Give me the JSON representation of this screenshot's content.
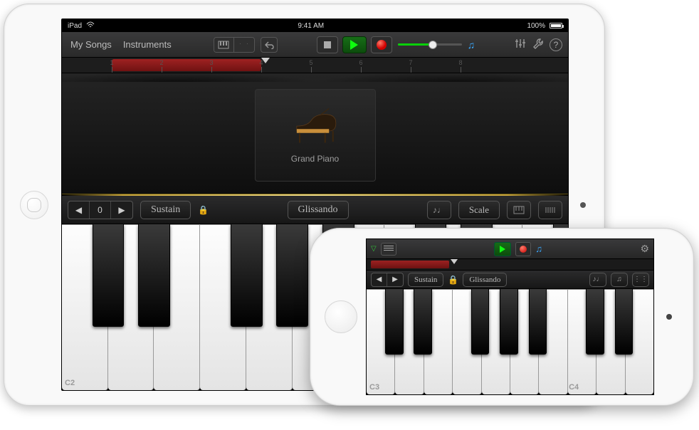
{
  "ipad": {
    "status": {
      "device": "iPad",
      "time": "9:41 AM",
      "battery": "100%"
    },
    "toolbar": {
      "my_songs": "My Songs",
      "instruments": "Instruments"
    },
    "ruler": {
      "bars": [
        "1",
        "2",
        "3",
        "4",
        "5",
        "6",
        "7",
        "8"
      ],
      "region_start_bar": 1,
      "region_end_bar": 4,
      "playhead_bar": 4
    },
    "instrument": {
      "name": "Grand Piano"
    },
    "controls": {
      "octave_value": "0",
      "sustain": "Sustain",
      "glissando": "Glissando",
      "scale": "Scale"
    },
    "keyboard": {
      "white_key_count": 11,
      "octave_label": "C2",
      "black_key_positions_pct": [
        6.0,
        15.1,
        33.3,
        42.4,
        51.5,
        69.7,
        78.8,
        97.0
      ]
    }
  },
  "iphone": {
    "ruler": {
      "region_start_bar": 1,
      "region_end_bar": 4
    },
    "controls": {
      "sustain": "Sustain",
      "glissando": "Glissando"
    },
    "keyboard": {
      "white_key_count": 10,
      "octave_labels": [
        "C3",
        "C4"
      ],
      "black_key_positions_pct": [
        6.5,
        16.5,
        36.5,
        46.5,
        56.5,
        76.5,
        86.5
      ]
    }
  }
}
